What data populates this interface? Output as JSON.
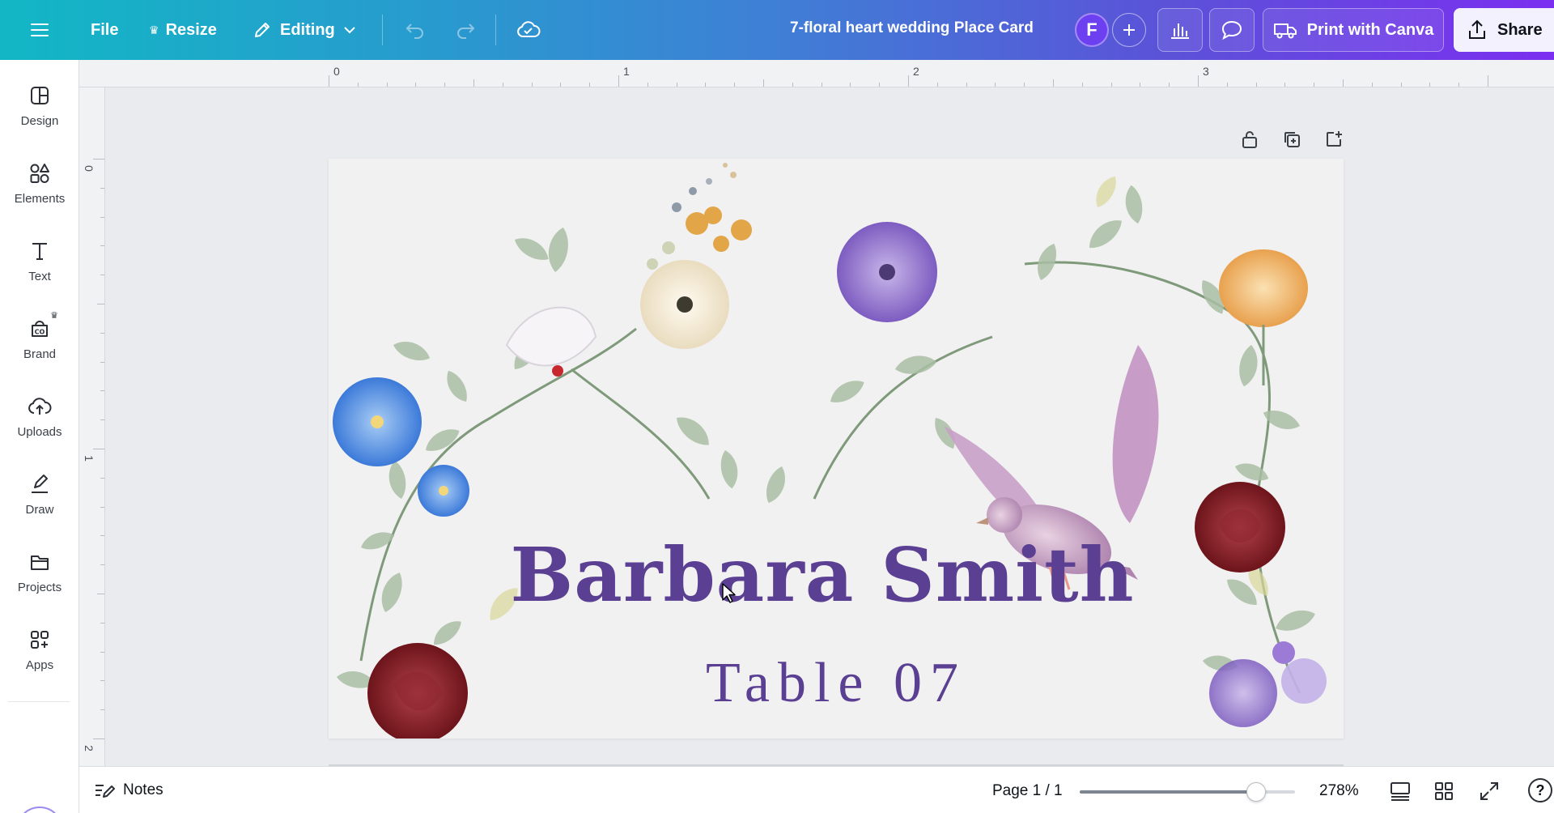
{
  "topbar": {
    "file_label": "File",
    "resize_label": "Resize",
    "editing_label": "Editing",
    "doc_title": "7-floral heart wedding  Place Card",
    "avatar_initial": "F",
    "print_label": "Print with Canva",
    "share_label": "Share"
  },
  "sidebar": {
    "items": [
      {
        "label": "Design",
        "icon": "design-icon"
      },
      {
        "label": "Elements",
        "icon": "elements-icon"
      },
      {
        "label": "Text",
        "icon": "text-icon"
      },
      {
        "label": "Brand",
        "icon": "brand-icon"
      },
      {
        "label": "Uploads",
        "icon": "uploads-icon"
      },
      {
        "label": "Draw",
        "icon": "draw-icon"
      },
      {
        "label": "Projects",
        "icon": "projects-icon"
      },
      {
        "label": "Apps",
        "icon": "apps-icon"
      }
    ]
  },
  "rulers": {
    "top": [
      "0",
      "1",
      "2",
      "3"
    ],
    "left": [
      "0",
      "1",
      "2"
    ]
  },
  "card": {
    "guest_name": "Barbara Smith",
    "table_label": "Table 07"
  },
  "bottombar": {
    "notes_label": "Notes",
    "page_indicator": "Page 1 / 1",
    "zoom_label": "278%",
    "zoom_level_fraction": 0.82
  },
  "colors": {
    "accent_purple": "#5a3f93",
    "topbar_start": "#12b7c5",
    "topbar_end": "#7b2ff0"
  }
}
